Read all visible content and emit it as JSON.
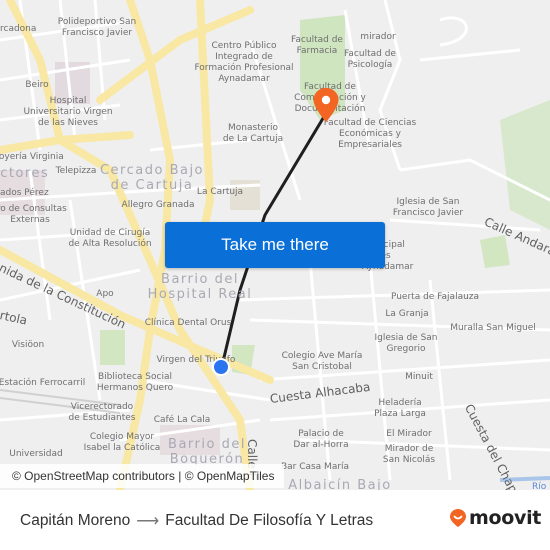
{
  "map": {
    "labels": {
      "polideportivo": "Polideportivo San\nFrancisco Javier",
      "arcadona": "rcadona",
      "beiro": "Beiro",
      "hospital": "Hospital\nUniversitario Virgen\nde las Nieves",
      "joyeria": "Joyería Virginia",
      "telepizza": "Telepizza",
      "dados_perez": "ados Pérez",
      "consultas": "tro de Consultas\nExternas",
      "unidad_cirugia": "Unidad de Cirugía\nde Alta Resolución",
      "apo": "Apo",
      "clinica": "Clínica Dental Orus",
      "visioon": "Visiöon",
      "estacion": "Estación Ferrocarril",
      "virgen_triunfo": "Virgen del Triunfo",
      "biblioteca": "Biblioteca Social\nHermanos Quero",
      "vicerrectorado": "Vicerectorado\nde Estudiantes",
      "cafe": "Café La Cala",
      "colegio_mayor": "Colegio Mayor\nIsabel la Católica",
      "universidad": "Universidad",
      "centro_publico": "Centro Público\nIntegrado de\nFormación Profesional\nAynadamar",
      "monasterio": "Monasterio\nde La Cartuja",
      "la_cartuja": "La Cartuja",
      "allegro": "Allegro Granada",
      "farmacia": "Facultad de\nFarmacia",
      "mirador": "mirador",
      "psicologia": "Facultad de\nPsicología",
      "comunicacion": "Facultad de\nComunicación y\nDocumentación",
      "ciencias_economicas": "Facultad de Ciencias\nEconómicas y\nEmpresariales",
      "iglesia_francisco": "Iglesia de San\nFrancisco Javier",
      "municipal": "Municipal\nportes\nAynadamar",
      "puerta_fajalauza": "Puerta de Fajalauza",
      "la_granja": "La Granja",
      "muralla": "Muralla San Miguel",
      "iglesia_gregorio": "Iglesia de San\nGregorio",
      "colegio_ave": "Colegio Ave María\nSan Cristobal",
      "minuit": "Minuit",
      "heladeria": "Heladería\nPlaza Larga",
      "palacio": "Palacio de\nDar al-Horra",
      "el_mirador": "El Mirador",
      "mirador_nicolas": "Mirador de\nSan Nicolás",
      "casa_maria": "Bar Casa María",
      "rio": "Río"
    },
    "districts": {
      "cercado": "Cercado Bajo\nde Cartuja",
      "doctores": "octores",
      "barrio_hospital": "Barrio del\nHospital Real",
      "barrio_boqueron": "Barrio del\nBoquerón",
      "albaicin": "Albaicín Bajo"
    },
    "streets": {
      "constitucion": "nida de la Constitución",
      "cuesta_alhacaba": "Cuesta Alhacaba",
      "cuesta_chapiz": "Cuesta del Chapiz",
      "calle_andarax": "Calle Andarax",
      "calle_elvira": "Calle E",
      "tola": "rtola"
    },
    "cta_label": "Take me there",
    "attribution": "© OpenStreetMap contributors | © OpenMapTiles",
    "colors": {
      "route_line": "#1f1f1f",
      "destination_pin": "#f26522",
      "origin_dot": "#2b74f0",
      "cta_bg": "#0a6fd6"
    }
  },
  "footer": {
    "origin": "Capitán Moreno",
    "arrow": "⟶",
    "destination": "Facultad De Filosofía Y Letras",
    "brand": "moovit",
    "brand_color": "#f26522"
  }
}
